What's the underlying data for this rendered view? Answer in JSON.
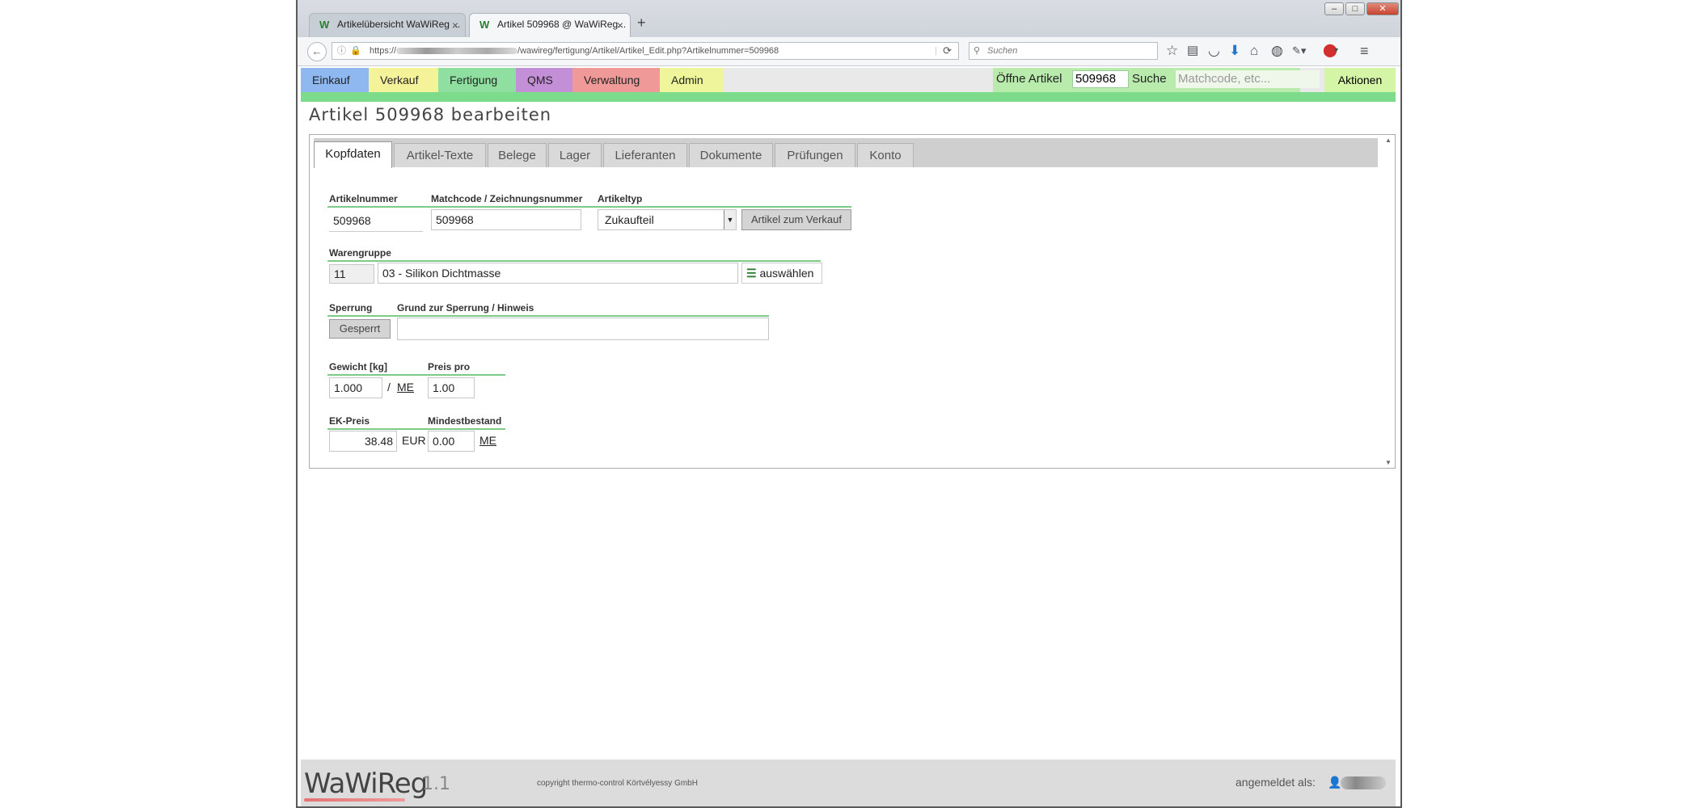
{
  "browser": {
    "tabs": [
      {
        "label": "Artikelübersicht WaWiReg ..."
      },
      {
        "label": "Artikel 509968 @ WaWiReg..."
      }
    ],
    "new_tab": "+",
    "url_prefix": "https://",
    "url_path": "/wawireg/fertigung/Artikel/Artikel_Edit.php?Artikelnummer=509968",
    "search_placeholder": "Suchen"
  },
  "menu": {
    "items": [
      {
        "label": "Einkauf",
        "color": "#8fb8f0"
      },
      {
        "label": "Verkauf",
        "color": "#f5f39a"
      },
      {
        "label": "Fertigung",
        "color": "#8fe0a0"
      },
      {
        "label": "QMS",
        "color": "#c38fd6"
      },
      {
        "label": "Verwaltung",
        "color": "#ef9a98"
      },
      {
        "label": "Admin",
        "color": "#eef59a"
      }
    ],
    "open_article_label": "Öffne Artikel",
    "open_article_value": "509968",
    "search_label": "Suche",
    "search_placeholder": "Matchcode, etc...",
    "actions_label": "Aktionen"
  },
  "page": {
    "title": "Artikel 509968 bearbeiten"
  },
  "tabs": [
    {
      "label": "Kopfdaten",
      "active": true
    },
    {
      "label": "Artikel-Texte",
      "active": false
    },
    {
      "label": "Belege",
      "active": false
    },
    {
      "label": "Lager",
      "active": false
    },
    {
      "label": "Lieferanten",
      "active": false
    },
    {
      "label": "Dokumente",
      "active": false
    },
    {
      "label": "Prüfungen",
      "active": false
    },
    {
      "label": "Konto",
      "active": false
    }
  ],
  "form": {
    "artikelnummer_label": "Artikelnummer",
    "artikelnummer_value": "509968",
    "matchcode_label": "Matchcode / Zeichnungsnummer",
    "matchcode_value": "509968",
    "artikeltyp_label": "Artikeltyp",
    "artikeltyp_value": "Zukaufteil",
    "to_sales_button": "Artikel zum Verkauf",
    "warengruppe_label": "Warengruppe",
    "warengruppe_id": "11",
    "warengruppe_name": "03 - Silikon Dichtmasse",
    "select_button": "auswählen",
    "sperrung_label": "Sperrung",
    "sperrung_button": "Gesperrt",
    "grund_label": "Grund zur Sperrung / Hinweis",
    "grund_value": "",
    "gewicht_label": "Gewicht [kg]",
    "gewicht_value": "1.000",
    "per_sep": "/",
    "me_unit": "ME",
    "preis_pro_label": "Preis pro",
    "preis_pro_value": "1.00",
    "ek_preis_label": "EK-Preis",
    "ek_preis_value": "38.48",
    "currency": "EUR",
    "mindestbestand_label": "Mindestbestand",
    "mindestbestand_value": "0.00",
    "mindest_unit": "ME"
  },
  "footer": {
    "logo": "WaWiReg",
    "version": "1.1",
    "copyright": "copyright thermo-control Körtvélyessy GmbH",
    "logged_in_label": "angemeldet als:"
  }
}
